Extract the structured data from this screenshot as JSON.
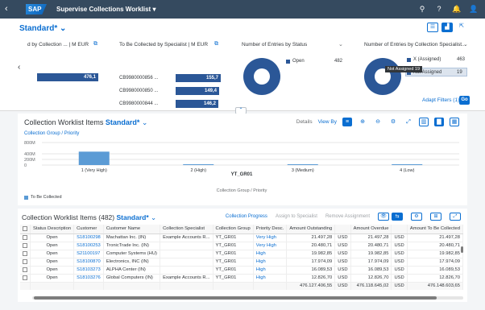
{
  "shell": {
    "back_icon": "chevron-left-icon",
    "logo": "SAP",
    "title": "Supervise Collections Worklist",
    "title_dropdown_icon": "caret-down-icon",
    "icons": [
      "search-icon",
      "help-icon",
      "notifications-icon",
      "user-icon"
    ],
    "icon_glyphs": [
      "⚲",
      "?",
      "🔔",
      "👤"
    ]
  },
  "header": {
    "variant": "Standard*",
    "variant_dropdown": "⌄",
    "nav_left": "‹",
    "cards": [
      {
        "title": "d by Collection ... | M EUR",
        "bars": [
          {
            "label": "",
            "value": "476,1"
          }
        ]
      },
      {
        "title": "To Be Collected by Specialist  | M EUR",
        "bars": [
          {
            "label": "CB9980000856 ...",
            "value": "155,7"
          },
          {
            "label": "CB9980000850 ...",
            "value": "149,4"
          },
          {
            "label": "CB9980000844 ...",
            "value": "146,2"
          }
        ]
      },
      {
        "title": "Number of Entries by Status",
        "legend": [
          {
            "label": "Open",
            "value": "482"
          }
        ]
      },
      {
        "title": "Number of Entries by Collection Specialist...",
        "legend": [
          {
            "label": "X (Assigned)",
            "value": "463"
          },
          {
            "label": "Not Assigned",
            "value": "19"
          }
        ],
        "tooltip": "Not Assigned 19"
      }
    ],
    "adapt_filters": "Adapt Filters (1)",
    "go": "Go",
    "collapse_glyph": "⌃"
  },
  "chart_panel": {
    "title": "Collection Worklist Items",
    "variant": "Standard*",
    "subtitle": "Collection Group / Priority",
    "tools": {
      "details": "Details",
      "view_by": "View By"
    },
    "tool_glyphs": [
      "≡",
      "⊕",
      "⊖",
      "⚙",
      "⤢",
      "▥",
      "▇",
      "▦",
      "▤"
    ],
    "legend": "To Be Collected"
  },
  "chart_data": {
    "type": "bar",
    "title": "",
    "series": [
      {
        "name": "To Be Collected",
        "values": [
          476,
          0,
          0,
          0
        ]
      }
    ],
    "categories": [
      "1 (Very High)",
      "2 (High)",
      "3 (Medium)",
      "4 (Low)"
    ],
    "series_group": "YT_GR01",
    "xlabel": "Collection Group / Priority",
    "ylabel": "",
    "y_ticks": [
      "800M",
      "400M",
      "200M",
      "0"
    ],
    "ylim": [
      0,
      800
    ],
    "legend_position": "bottom-left",
    "color": "#5b9bd5"
  },
  "table_panel": {
    "title": "Collection Worklist Items (482)",
    "variant": "Standard*",
    "actions": {
      "collection_progress": "Collection Progress",
      "assign": "Assign to Specialist",
      "remove": "Remove Assignment"
    },
    "tool_glyphs": [
      "👁",
      "⇆",
      "⚙",
      "⊞",
      "⤢"
    ],
    "columns": [
      "",
      "Status Description",
      "Customer",
      "Customer Name",
      "Collection Specialist",
      "Collection Group",
      "Priority Desc.",
      "Amount Outstanding",
      "",
      "Amount Overdue",
      "",
      "Amount To Be Collected"
    ],
    "rows": [
      [
        "",
        "Open",
        "S18100298",
        "Machattan Inc. (IN)",
        "Example Accounts R...",
        "YT_GR01",
        "Very High",
        "21.497,28",
        "USD",
        "21.497,28",
        "USD",
        "21.497,28"
      ],
      [
        "",
        "Open",
        "S18100253",
        "TronicTrade Inc. (IN)",
        "",
        "YT_GR01",
        "Very High",
        "20.480,71",
        "USD",
        "20.480,71",
        "USD",
        "20.480,71"
      ],
      [
        "",
        "Open",
        "S21100197",
        "Computer Systems (HU)",
        "",
        "YT_GR01",
        "High",
        "19.982,85",
        "USD",
        "19.982,85",
        "USD",
        "19.982,85"
      ],
      [
        "",
        "Open",
        "S18100870",
        "Electronics, INC (IN)",
        "",
        "YT_GR01",
        "High",
        "17.974,09",
        "USD",
        "17.974,09",
        "USD",
        "17.974,09"
      ],
      [
        "",
        "Open",
        "S18103273",
        "ALPHA Center (IN)",
        "",
        "YT_GR01",
        "High",
        "16.089,53",
        "USD",
        "16.089,53",
        "USD",
        "16.089,53"
      ],
      [
        "",
        "Open",
        "S18103276",
        "Global Computers (IN)",
        "Example Accounts R...",
        "YT_GR01",
        "High",
        "12.826,70",
        "USD",
        "12.826,70",
        "USD",
        "12.826,70"
      ]
    ],
    "totals": {
      "outstanding": "476.127.406,55",
      "outstanding_cur": "USD",
      "overdue": "476.118.645,02",
      "overdue_cur": "USD",
      "to_collect": "476.148.603,65"
    }
  },
  "colors": {
    "shell": "#354a5f",
    "accent": "#0a6ed1",
    "bar": "#2b5797",
    "chart_bar": "#5b9bd5"
  }
}
